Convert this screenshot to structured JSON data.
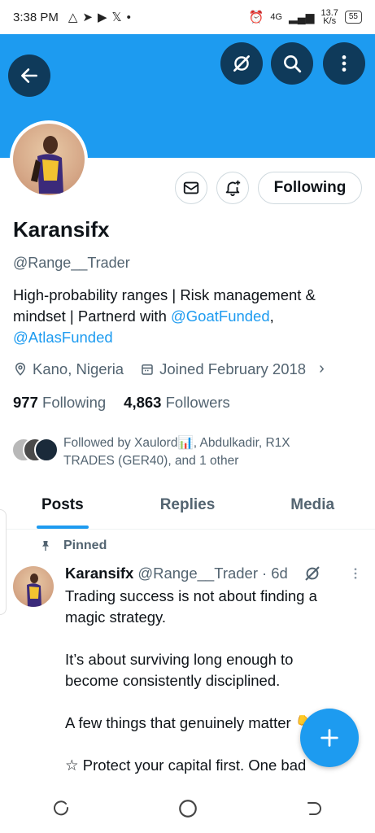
{
  "status_bar": {
    "time": "3:38 PM",
    "network": "4G",
    "speed_value": "13.7",
    "speed_unit": "K/s",
    "battery": "55"
  },
  "profile": {
    "name": "Karansifx",
    "handle": "@Range__Trader",
    "bio_text": "High-probability ranges | Risk management & mindset | Partnerd with ",
    "bio_link1": "@GoatFunded",
    "bio_sep": ",",
    "bio_link2": "@AtlasFunded",
    "location": "Kano, Nigeria",
    "joined": "Joined February 2018",
    "following_count": "977",
    "following_label": "Following",
    "followers_count": "4,863",
    "followers_label": "Followers",
    "followed_by": "Followed by Xaulord📊, Abdulkadir, R1X TRADES (GER40), and 1 other",
    "following_button": "Following"
  },
  "tabs": [
    {
      "label": "Posts",
      "active": true
    },
    {
      "label": "Replies",
      "active": false
    },
    {
      "label": "Media",
      "active": false
    }
  ],
  "pinned_label": "Pinned",
  "tweet": {
    "name": "Karansifx",
    "handle": "@Range__Trader",
    "dot": "·",
    "time": "6d",
    "body": "Trading success is not about finding a magic strategy.\n\nIt’s about surviving long enough to become consistently disciplined.\n\nA few things that genuinely matter 👇\n\n☆ Protect your capital first. One bad"
  },
  "colors": {
    "accent": "#1d9bf0",
    "banner": "#1d9bf0",
    "button_dark": "#0f3a5a"
  }
}
